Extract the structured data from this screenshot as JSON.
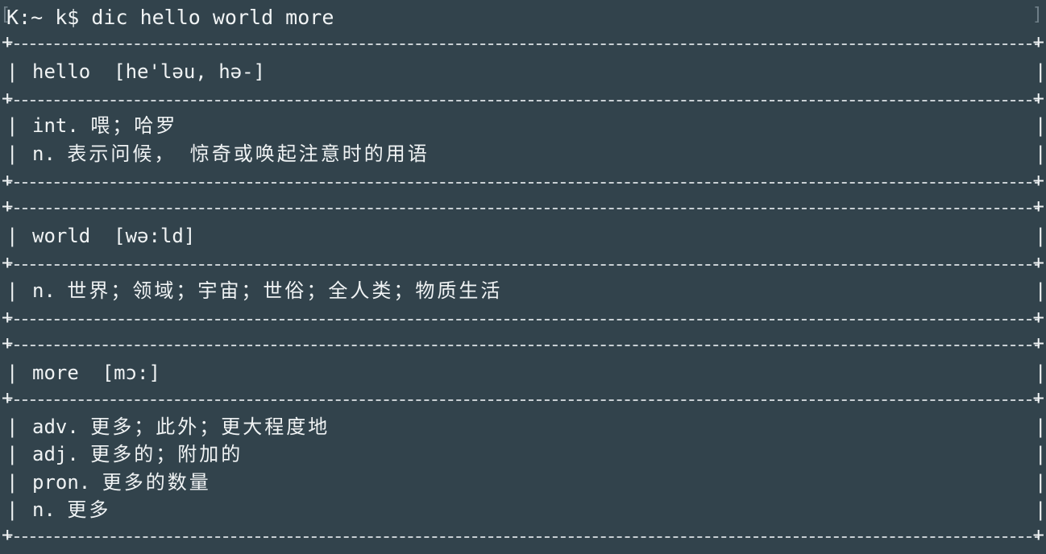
{
  "terminal": {
    "left_bracket": "[",
    "right_bracket": "]",
    "prompt": "K:~ k$ dic hello world more"
  },
  "entries": [
    {
      "word": "hello",
      "phonetic": "[he'ləu, hə-]",
      "definitions": [
        {
          "pos": "int.",
          "meaning": "喂；哈罗"
        },
        {
          "pos": "n.",
          "meaning": "表示问候， 惊奇或唤起注意时的用语"
        }
      ]
    },
    {
      "word": "world",
      "phonetic": "[wə:ld]",
      "definitions": [
        {
          "pos": "n.",
          "meaning": "世界；领域；宇宙；世俗；全人类；物质生活"
        }
      ]
    },
    {
      "word": "more",
      "phonetic": "[mɔ:]",
      "definitions": [
        {
          "pos": "adv.",
          "meaning": "更多；此外；更大程度地"
        },
        {
          "pos": "adj.",
          "meaning": "更多的；附加的"
        },
        {
          "pos": "pron.",
          "meaning": "更多的数量"
        },
        {
          "pos": "n.",
          "meaning": "更多"
        }
      ]
    }
  ]
}
